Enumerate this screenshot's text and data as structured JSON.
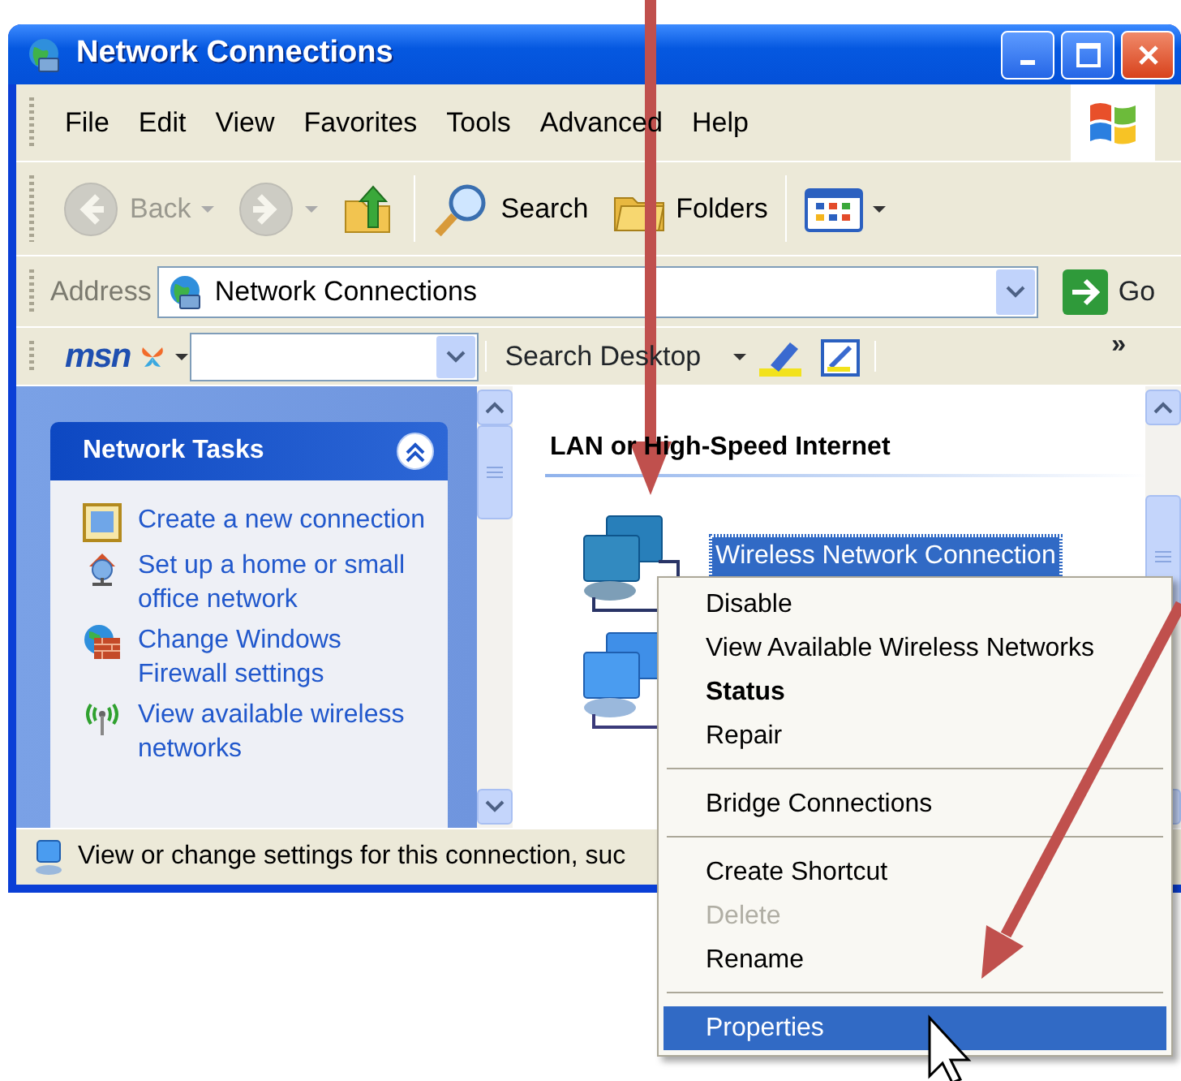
{
  "window": {
    "title": "Network Connections"
  },
  "menu_bar": [
    "File",
    "Edit",
    "View",
    "Favorites",
    "Tools",
    "Advanced",
    "Help"
  ],
  "toolbar": [
    {
      "kind": "back",
      "label": "Back",
      "disabled": true
    },
    {
      "kind": "forward",
      "disabled": true
    },
    {
      "kind": "up",
      "disabled": false
    },
    {
      "kind": "search",
      "label": "Search",
      "disabled": false
    },
    {
      "kind": "folders",
      "label": "Folders",
      "disabled": false
    },
    {
      "kind": "views",
      "disabled": false
    }
  ],
  "address_bar": {
    "label": "Address",
    "value": "Network Connections",
    "go_label": "Go"
  },
  "msn_bar": {
    "logo": "msn",
    "search_label": "Search Desktop",
    "overflow": "»"
  },
  "task_panel": {
    "title": "Network Tasks",
    "expanded": true,
    "items": [
      {
        "kind": "new-connection",
        "label": "Create a new connection"
      },
      {
        "kind": "home-network",
        "label": "Set up a home or small office network"
      },
      {
        "kind": "firewall",
        "label": "Change Windows Firewall settings"
      },
      {
        "kind": "wireless",
        "label": "View available wireless networks"
      }
    ]
  },
  "connections": {
    "heading": "LAN or High-Speed Internet",
    "items": [
      {
        "label": "Wireless Network Connection",
        "selected": true
      },
      {
        "selected": false
      }
    ]
  },
  "status_bar": {
    "text": "View or change settings for this connection, suc"
  },
  "context_menu": [
    {
      "kind": "item",
      "label": "Disable",
      "bold": false,
      "disabled": false,
      "selected": false
    },
    {
      "kind": "item",
      "label": "View Available Wireless Networks",
      "bold": false,
      "disabled": false,
      "selected": false
    },
    {
      "kind": "item",
      "label": "Status",
      "bold": true,
      "disabled": false,
      "selected": false
    },
    {
      "kind": "item",
      "label": "Repair",
      "bold": false,
      "disabled": false,
      "selected": false
    },
    {
      "kind": "separator"
    },
    {
      "kind": "item",
      "label": "Bridge Connections",
      "bold": false,
      "disabled": false,
      "selected": false
    },
    {
      "kind": "separator"
    },
    {
      "kind": "item",
      "label": "Create Shortcut",
      "bold": false,
      "disabled": false,
      "selected": false
    },
    {
      "kind": "item",
      "label": "Delete",
      "bold": false,
      "disabled": true,
      "selected": false
    },
    {
      "kind": "item",
      "label": "Rename",
      "bold": false,
      "disabled": false,
      "selected": false
    },
    {
      "kind": "separator"
    },
    {
      "kind": "item",
      "label": "Properties",
      "bold": false,
      "disabled": false,
      "selected": true
    }
  ]
}
